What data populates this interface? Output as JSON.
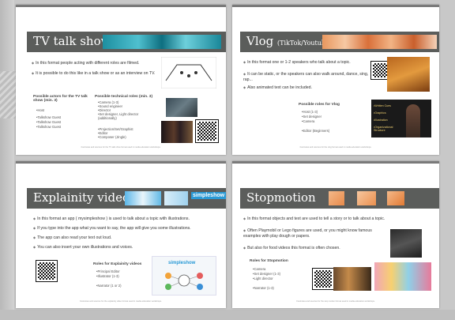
{
  "slides": {
    "tv": {
      "title": "TV talk show",
      "bullets": [
        "In this format people acting with different roles are filmed.",
        "It is possible to do this like in a talk show or as an interview on TV."
      ],
      "roles_title": "Possible actors for the TV talk show (min. 3)",
      "roles": [
        "Host",
        "Talkshow Guest",
        "Talkshow Guest",
        "Talkshow Guest"
      ],
      "tech_title": "Possible technical roles (min. 3)",
      "tech": [
        "Camera (1-3)",
        "Sound engineer",
        "Director",
        "Set designer, Light director (additionally)",
        "Projection/Set/Graphist",
        "Editor",
        "Composer (Jingle)"
      ],
      "footer": "Footnotes and sources for the TV talk show format used in media education workshops."
    },
    "vlog": {
      "title": "Vlog",
      "title_sub": "(TikTok/Youtube)",
      "bullets": [
        "In this format one or 1-2 speakers who talk about a topic.",
        "It can be static, or the speakers can also walk around, dance, sing, rap...",
        "Also animated text can be included."
      ],
      "roles_title": "Possible roles for Vlog",
      "roles": [
        "Host (1-3)",
        "Set designer",
        "Camera",
        "",
        "Editor (Beginners)"
      ],
      "image_words": [
        "Written Cues",
        "Graphics",
        "Illustration",
        "Organizational Structure"
      ],
      "footer": "Footnotes and sources for the vlog format used in media education workshops."
    },
    "explain": {
      "title": "Explainity video",
      "brand": "simpleshow",
      "bullets": [
        "In this format an app ( mysimpleshow ) is used to talk about a topic with illustrations.",
        "If you type into the app what you want to say, the app will give you some illustrations.",
        "The app can also read your text out loud.",
        "You can also insert your own illustrations and voices."
      ],
      "roles_title": "Roles for Explainity videos",
      "roles": [
        "Principal Editor",
        "Illustrator (1-3)",
        "",
        "Narrator (1 or 2)"
      ],
      "card_brand": "simpleshow",
      "footer": "Footnotes and sources for the explainity video format used in media education workshops."
    },
    "stop": {
      "title": "Stopmotion",
      "bullets": [
        "In this format objects and text are used to tell a story or to talk about a topic.",
        "Often Playmobil or Lego figures are used, or you might know famous examples with play dough or papers.",
        "But also for food videos this format is often chosen."
      ],
      "roles_title": "Roles for Stopmotion",
      "roles": [
        "Camera",
        "Set designer (1-3)",
        "Light director",
        "",
        "Narrator (1-3)"
      ],
      "footer": "Footnotes and sources for the stop motion format used in media education workshops."
    }
  }
}
